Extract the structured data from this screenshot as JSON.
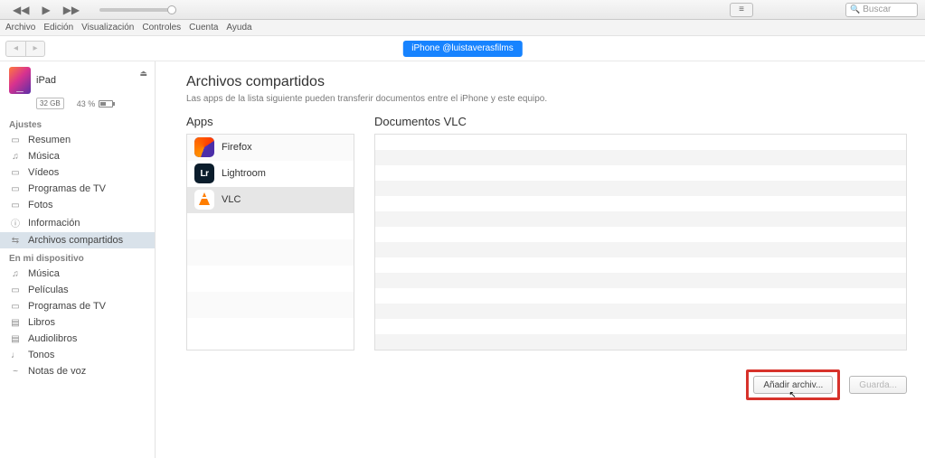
{
  "toolbar": {
    "search_placeholder": "Buscar"
  },
  "menubar": [
    "Archivo",
    "Edición",
    "Visualización",
    "Controles",
    "Cuenta",
    "Ayuda"
  ],
  "device_badge": "iPhone @luistaverasfilms",
  "device": {
    "name": "iPad",
    "capacity": "32 GB",
    "battery_pct": "43 %"
  },
  "sidebar": {
    "section_settings": "Ajustes",
    "settings_items": [
      {
        "icon": "▭",
        "label": "Resumen"
      },
      {
        "icon": "♫",
        "label": "Música"
      },
      {
        "icon": "▭",
        "label": "Vídeos"
      },
      {
        "icon": "▭",
        "label": "Programas de TV"
      },
      {
        "icon": "▭",
        "label": "Fotos"
      },
      {
        "icon": "ⓘ",
        "label": "Información"
      },
      {
        "icon": "⇆",
        "label": "Archivos compartidos"
      }
    ],
    "section_device": "En mi dispositivo",
    "device_items": [
      {
        "icon": "♫",
        "label": "Música"
      },
      {
        "icon": "▭",
        "label": "Películas"
      },
      {
        "icon": "▭",
        "label": "Programas de TV"
      },
      {
        "icon": "▤",
        "label": "Libros"
      },
      {
        "icon": "▤",
        "label": "Audiolibros"
      },
      {
        "icon": "♩",
        "label": "Tonos"
      },
      {
        "icon": "~",
        "label": "Notas de voz"
      }
    ]
  },
  "content": {
    "title": "Archivos compartidos",
    "subtitle": "Las apps de la lista siguiente pueden transferir documentos entre el iPhone y este equipo.",
    "apps_header": "Apps",
    "docs_header": "Documentos VLC",
    "apps": [
      {
        "name": "Firefox",
        "sel": false,
        "ico": "firefox",
        "txt": ""
      },
      {
        "name": "Lightroom",
        "sel": false,
        "ico": "lr",
        "txt": "Lr"
      },
      {
        "name": "VLC",
        "sel": true,
        "ico": "vlc",
        "txt": ""
      }
    ],
    "add_button": "Añadir archiv...",
    "save_button": "Guarda..."
  }
}
